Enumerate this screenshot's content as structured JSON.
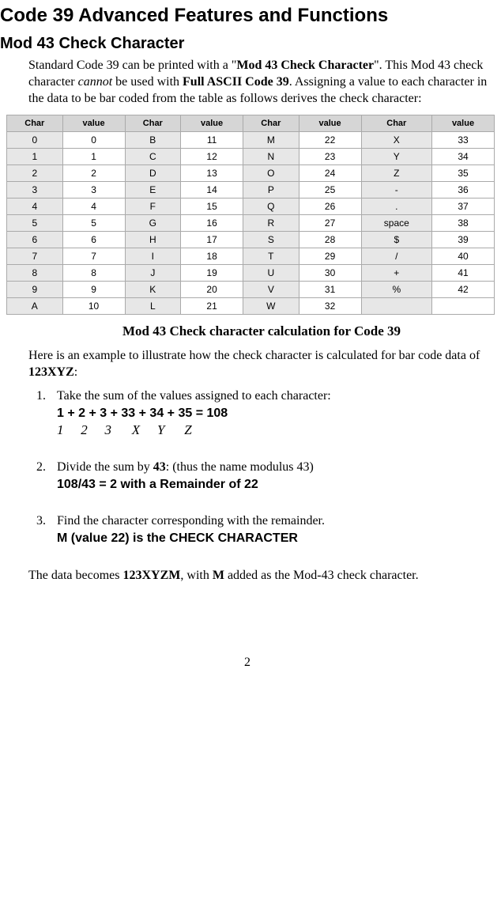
{
  "h1": "Code 39 Advanced Features and Functions",
  "h2": "Mod 43 Check Character",
  "intro": {
    "pre": "Standard Code 39 can be printed with a \"",
    "bold1": "Mod 43 Check Character",
    "mid1": "\". This Mod 43 check character ",
    "ital": "cannot",
    "mid2": " be used with ",
    "bold2": "Full ASCII Code 39",
    "post": ". Assigning a value to each character in the data to be bar coded from the table as follows derives the check character:"
  },
  "table": {
    "headers": [
      "Char",
      "value",
      "Char",
      "value",
      "Char",
      "value",
      "Char",
      "value"
    ],
    "rows": [
      [
        "0",
        "0",
        "B",
        "11",
        "M",
        "22",
        "X",
        "33"
      ],
      [
        "1",
        "1",
        "C",
        "12",
        "N",
        "23",
        "Y",
        "34"
      ],
      [
        "2",
        "2",
        "D",
        "13",
        "O",
        "24",
        "Z",
        "35"
      ],
      [
        "3",
        "3",
        "E",
        "14",
        "P",
        "25",
        "-",
        "36"
      ],
      [
        "4",
        "4",
        "F",
        "15",
        "Q",
        "26",
        ".",
        "37"
      ],
      [
        "5",
        "5",
        "G",
        "16",
        "R",
        "27",
        "space",
        "38"
      ],
      [
        "6",
        "6",
        "H",
        "17",
        "S",
        "28",
        "$",
        "39"
      ],
      [
        "7",
        "7",
        "I",
        "18",
        "T",
        "29",
        "/",
        "40"
      ],
      [
        "8",
        "8",
        "J",
        "19",
        "U",
        "30",
        "+",
        "41"
      ],
      [
        "9",
        "9",
        "K",
        "20",
        "V",
        "31",
        "%",
        "42"
      ],
      [
        "A",
        "10",
        "L",
        "21",
        "W",
        "32",
        "",
        ""
      ]
    ]
  },
  "caption": "Mod 43 Check character calculation for Code 39",
  "example_lead": {
    "pre": "Here is an example to illustrate how the check character is calculated for bar code data of ",
    "bold": "123XYZ",
    "post": ":"
  },
  "steps": {
    "s1": {
      "text": "Take the sum of the values assigned to each character:",
      "calc": "1 + 2 + 3 + 33 + 34 + 35 = 108",
      "letters": [
        "1",
        "2",
        "3",
        "X",
        "Y",
        "Z"
      ]
    },
    "s2": {
      "pre": "Divide the sum by ",
      "bold": "43",
      "post": ": (thus the name modulus 43)",
      "calc": "108/43 = 2 with a Remainder of 22"
    },
    "s3": {
      "text": "Find the character corresponding with the remainder.",
      "calc": "M (value 22) is the CHECK CHARACTER"
    }
  },
  "conclusion": {
    "pre": "The data becomes ",
    "bold1": "123XYZM",
    "mid": ", with ",
    "bold2": "M",
    "post": " added as the Mod-43 check character."
  },
  "pagenum": "2"
}
